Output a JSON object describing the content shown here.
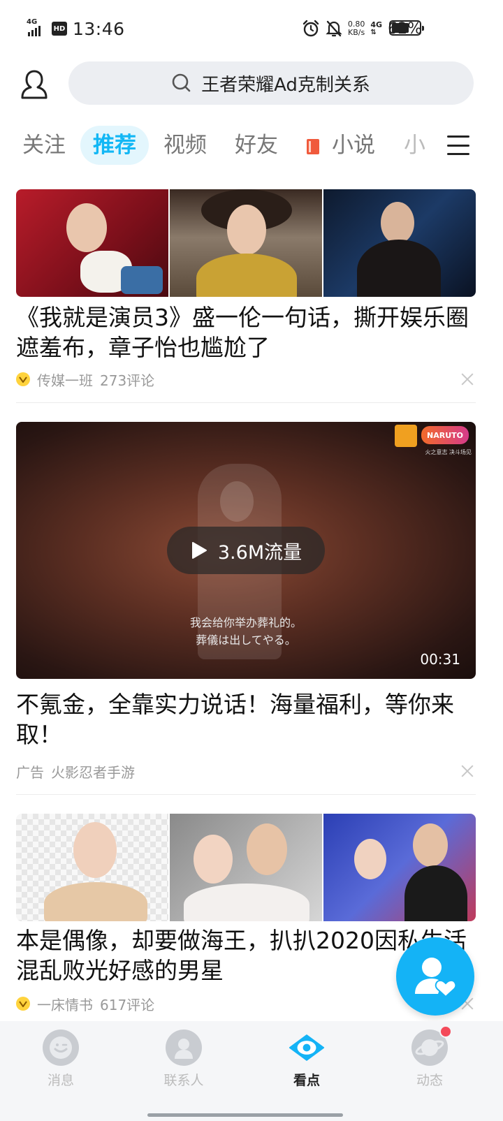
{
  "status_bar": {
    "network": "4G",
    "hd": "HD",
    "time": "13:46",
    "net_speed_value": "0.80",
    "net_speed_unit": "KB/s",
    "network2": "4G",
    "battery_percent": "62%",
    "battery_level": 0.62
  },
  "header": {
    "search_text": "王者荣耀Ad克制关系"
  },
  "tabs": [
    {
      "label": "关注"
    },
    {
      "label": "推荐",
      "active": true
    },
    {
      "label": "视频"
    },
    {
      "label": "好友"
    },
    {
      "label": "小说"
    },
    {
      "label": "小"
    }
  ],
  "feed": [
    {
      "type": "image-post",
      "title": "《我就是演员3》盛一伦一句话，撕开娱乐圈遮羞布，章子怡也尴尬了",
      "source": "传媒一班",
      "comments": "273评论"
    },
    {
      "type": "video-ad",
      "play_label": "3.6M流量",
      "subtitle_line1": "我会给你举办葬礼的。",
      "subtitle_line2": "葬儀は出してやる。",
      "duration": "00:31",
      "game_logo_text": "NARUTO",
      "game_logo_sub": "火之意志 决斗场见",
      "title": "不氪金，全靠实力说话！海量福利，等你来取！",
      "ad_label": "广告",
      "source": "火影忍者手游"
    },
    {
      "type": "image-post",
      "title": "本是偶像，却要做海王，扒扒2020因私生活混乱败光好感的男星",
      "source": "一床情书",
      "comments": "617评论"
    }
  ],
  "bottom_nav": [
    {
      "label": "消息",
      "icon": "message-icon"
    },
    {
      "label": "联系人",
      "icon": "contacts-icon"
    },
    {
      "label": "看点",
      "icon": "eye-icon",
      "active": true
    },
    {
      "label": "动态",
      "icon": "planet-icon",
      "badge": true
    }
  ],
  "colors": {
    "accent": "#12b7f5",
    "tab_active_bg": "#e3f6fd",
    "fab": "#14b3f6",
    "badge": "#f44a5a"
  }
}
